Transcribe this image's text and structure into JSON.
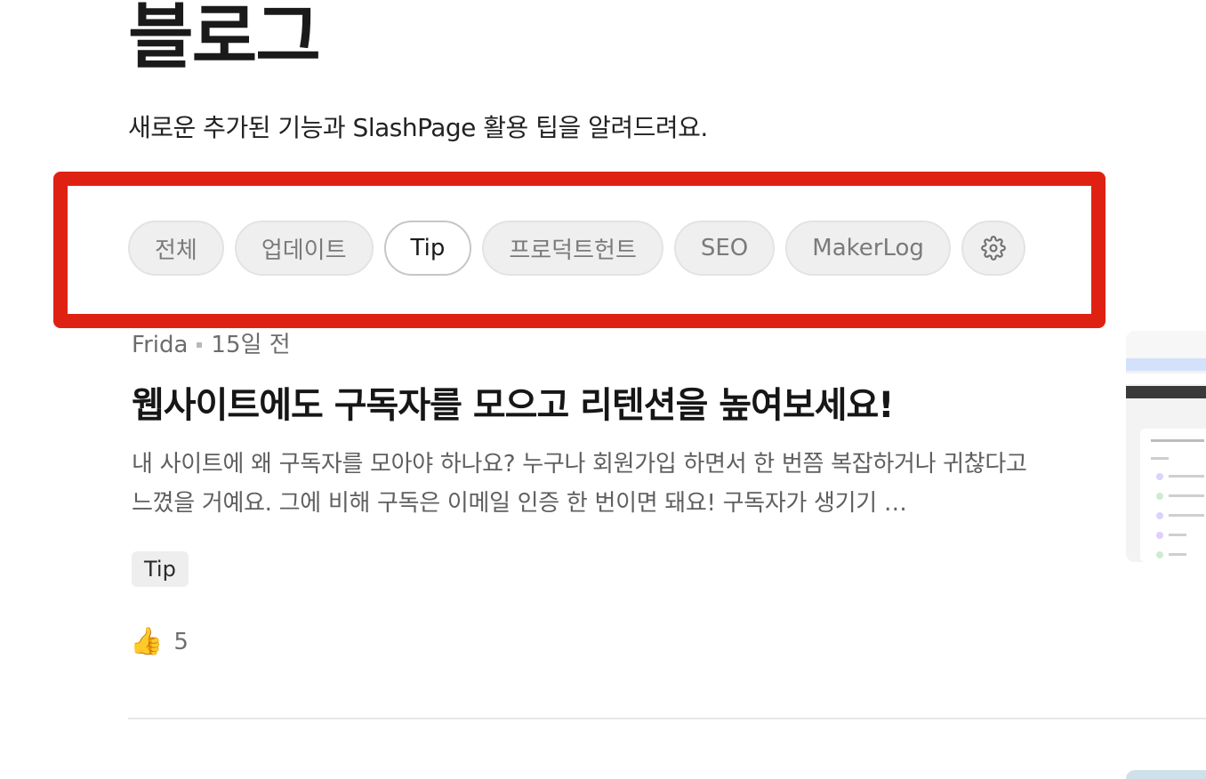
{
  "page": {
    "title": "블로그",
    "subtitle": "새로운 추가된 기능과 SlashPage 활용 팁을 알려드려요."
  },
  "filters": {
    "items": [
      {
        "label": "전체",
        "active": false
      },
      {
        "label": "업데이트",
        "active": false
      },
      {
        "label": "Tip",
        "active": true
      },
      {
        "label": "프로덕트헌트",
        "active": false
      },
      {
        "label": "SEO",
        "active": false
      },
      {
        "label": "MakerLog",
        "active": false
      }
    ],
    "settings_icon": "gear-icon"
  },
  "post": {
    "author": "Frida",
    "time": "15일 전",
    "title": "웹사이트에도 구독자를 모으고 리텐션을 높여보세요!",
    "excerpt": "내 사이트에 왜 구독자를 모아야 하나요? 누구나 회원가입 하면서 한 번쯤 복잡하거나 귀찮다고 느꼈을 거예요. 그에 비해 구독은 이메일 인증 한 번이면 돼요! 구독자가 생기기 …",
    "tag": "Tip",
    "reaction_icon": "thumbs-up-icon",
    "reaction_emoji": "👍",
    "likes": "5"
  },
  "colors": {
    "highlight": "#df2113",
    "chip_bg": "#efefef",
    "chip_active_border": "#c6c6c6"
  }
}
